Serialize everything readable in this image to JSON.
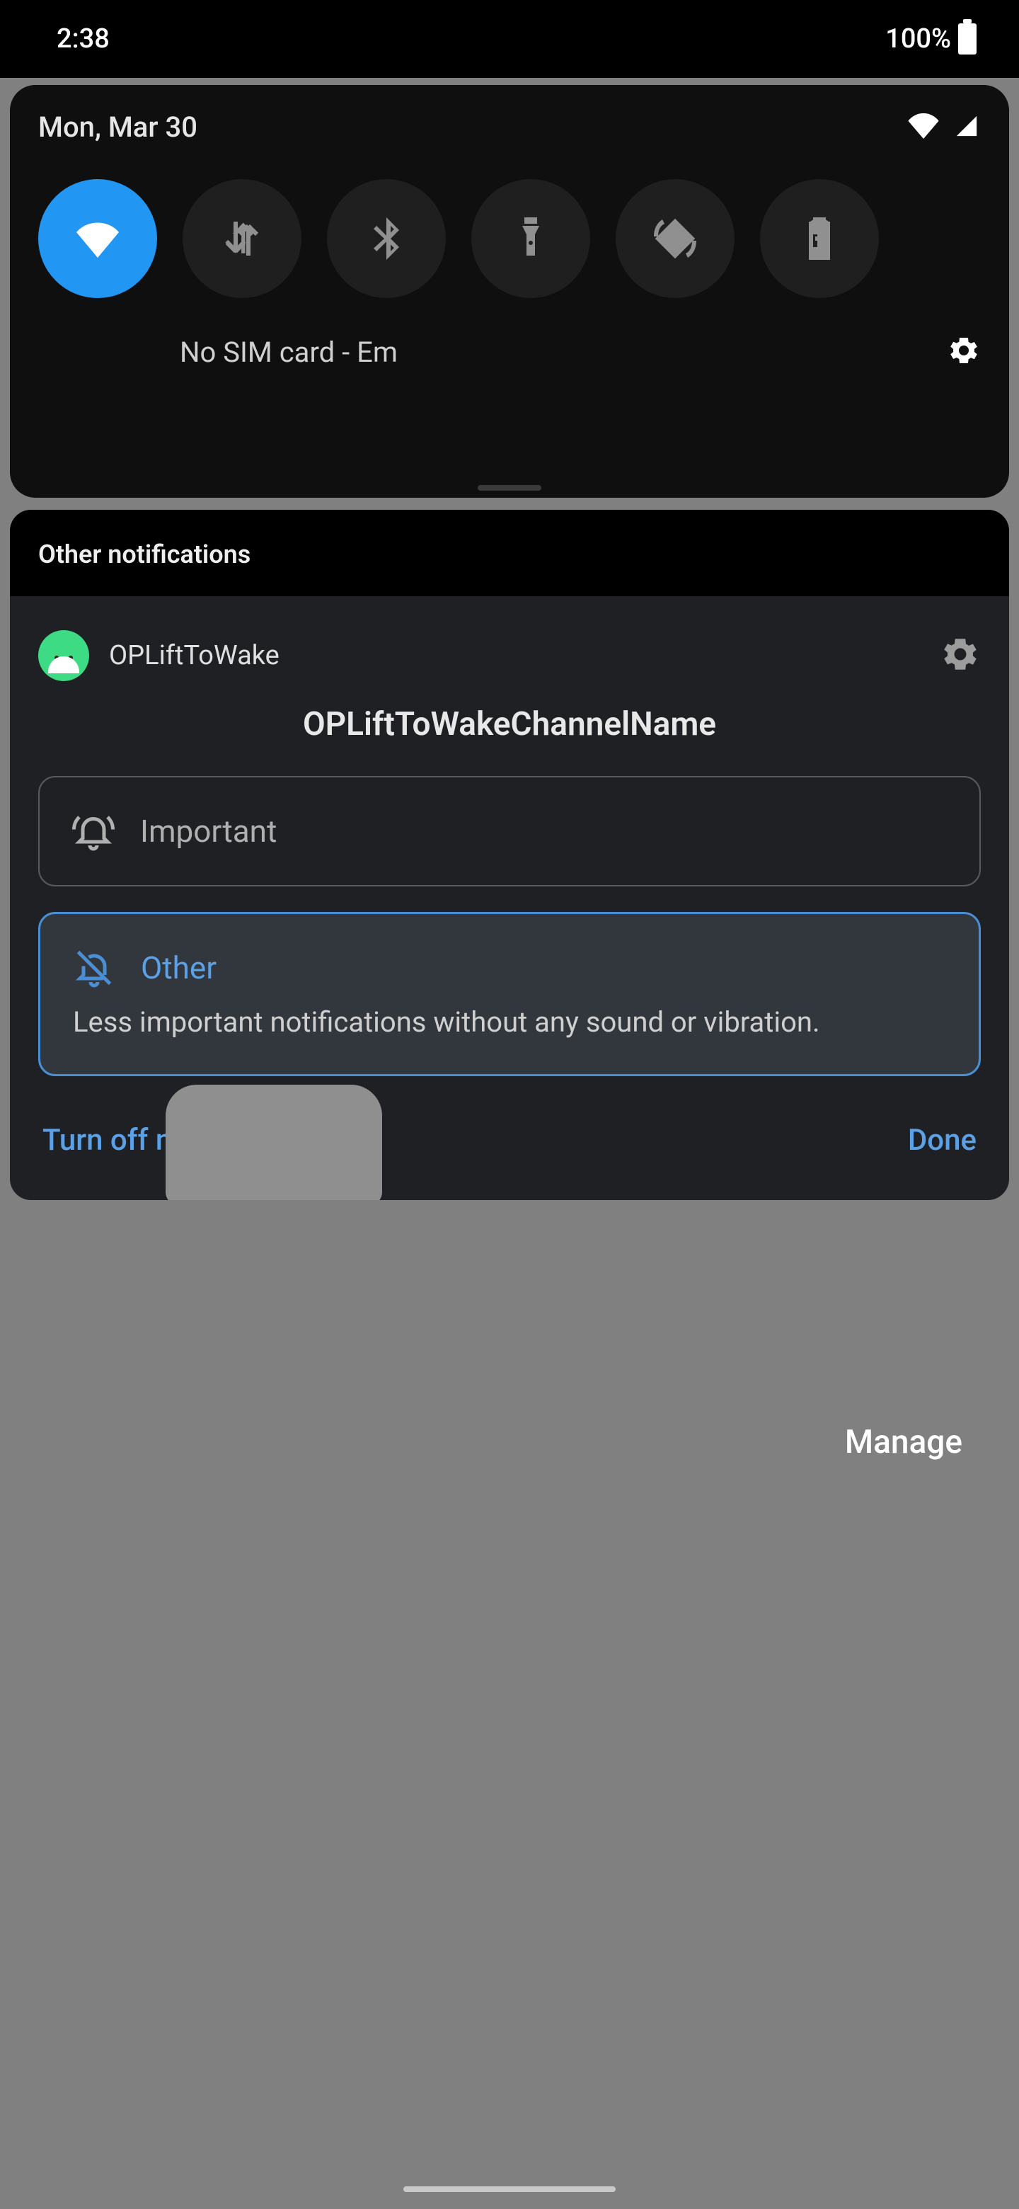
{
  "statusbar": {
    "time": "2:38",
    "battery_pct": "100%"
  },
  "qs": {
    "date": "Mon, Mar 30",
    "carrier": "No SIM card - Em"
  },
  "section": {
    "header": "Other notifications"
  },
  "notif": {
    "app": "OPLiftToWake",
    "channel": "OPLiftToWakeChannelName",
    "option_important": "Important",
    "option_other_title": "Other",
    "option_other_desc": "Less important notifications without any sound or vibration.",
    "turn_off": "Turn off notifications",
    "done": "Done"
  },
  "manage": "Manage"
}
